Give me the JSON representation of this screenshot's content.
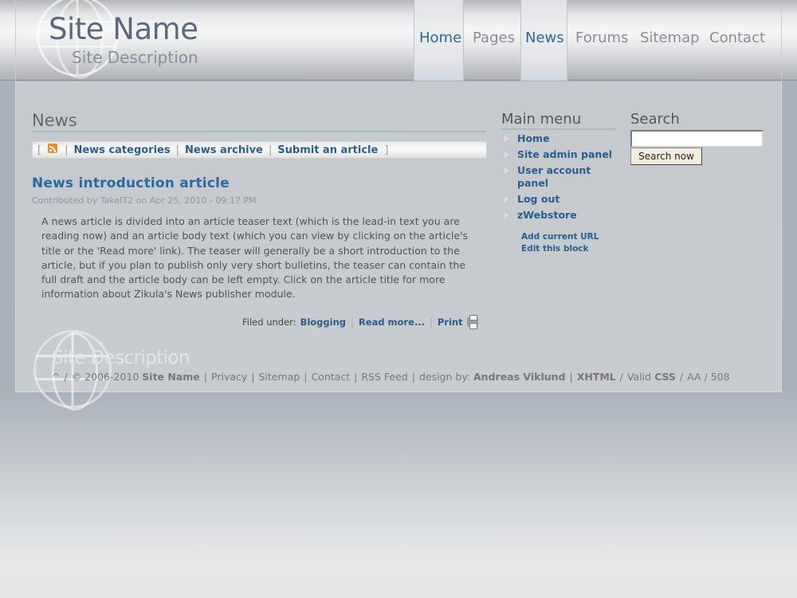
{
  "header": {
    "site_name": "Site Name",
    "site_description": "Site Description"
  },
  "nav": {
    "items": [
      {
        "label": "Home",
        "active": true
      },
      {
        "label": "Pages",
        "active": false
      },
      {
        "label": "News",
        "active": true
      },
      {
        "label": "Forums",
        "active": false
      },
      {
        "label": "Sitemap",
        "active": false
      },
      {
        "label": "Contact",
        "active": false
      }
    ]
  },
  "news": {
    "heading": "News",
    "toolbar": {
      "open_bracket": "[",
      "close_bracket": "]",
      "separator": "|",
      "links": [
        "News categories",
        "News archive",
        "Submit an article"
      ]
    }
  },
  "article": {
    "title": "News introduction article",
    "meta": "Contributed by TakeIT2 on Apr 25, 2010 - 09:17 PM",
    "body": "A news article is divided into an article teaser text (which is the lead-in text you are reading now) and an article body text (which you can view by clicking on the article's title or the 'Read more' link). The teaser will generally be a short introduction to the article, but if you plan to publish only very short bulletins, the teaser can contain the full draft and the article body can be left empty. Click on the article title for more information about Zikula's News publisher module.",
    "filed_label": "Filed under:",
    "category": "Blogging",
    "read_more": "Read more...",
    "print": "Print"
  },
  "main_menu": {
    "heading": "Main menu",
    "items": [
      "Home",
      "Site admin panel",
      "User account panel",
      "Log out",
      "zWebstore"
    ],
    "add_url": "Add current URL",
    "edit_block": "Edit this block"
  },
  "search": {
    "heading": "Search",
    "placeholder": "",
    "button": "Search now"
  },
  "footer": {
    "description": "Site Description",
    "top_link": "^",
    "copyright": "© 2006-2010",
    "site_name": "Site Name",
    "privacy": "Privacy",
    "sitemap": "Sitemap",
    "contact": "Contact",
    "rss": "RSS Feed",
    "design_by": "design by:",
    "designer": "Andreas Viklund",
    "xhtml": "XHTML",
    "valid": "Valid",
    "css": "CSS",
    "aa": "AA / 508"
  }
}
